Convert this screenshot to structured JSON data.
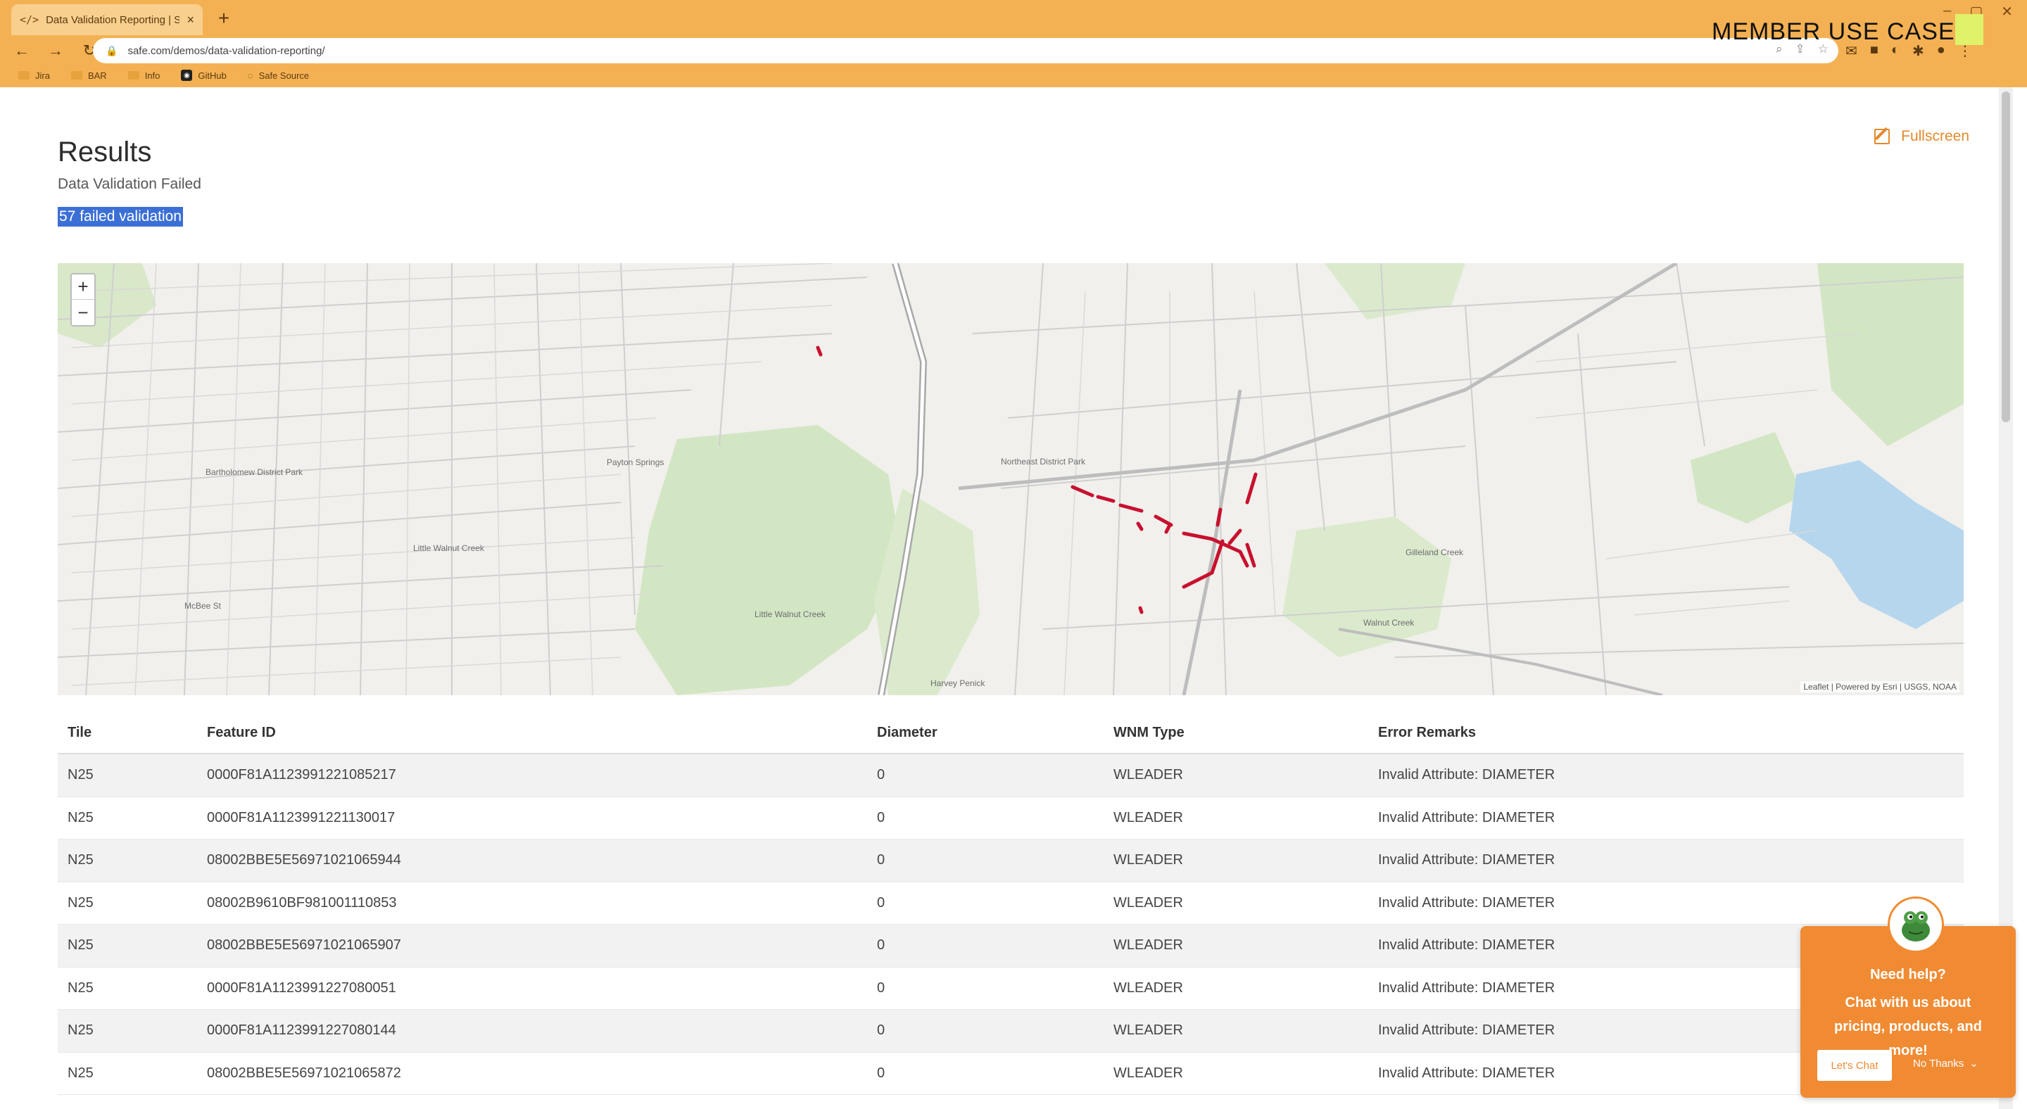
{
  "browser": {
    "tab_title": "Data Validation Reporting | Safe",
    "tab_icon": "</>",
    "new_tab": "+",
    "url": "safe.com/demos/data-validation-reporting/",
    "bookmarks": [
      "Jira",
      "BAR",
      "Info",
      "GitHub",
      "Safe Source"
    ]
  },
  "overlay": {
    "member_label": "MEMBER USE CASE"
  },
  "page": {
    "title": "Results",
    "subtitle": "Data Validation Failed",
    "failed_count": "57 failed validation",
    "fullscreen_label": "Fullscreen"
  },
  "map": {
    "zoom_in": "+",
    "zoom_out": "−",
    "attribution": "Leaflet | Powered by Esri | USGS, NOAA",
    "labels": [
      "Little Walnut Creek",
      "Little Walnut Creek",
      "Northeast District Park",
      "Gilleland Creek",
      "Walnut Creek",
      "Harvey Penick",
      "Payton Springs",
      "Bartholomew District Park",
      "McBee St"
    ]
  },
  "table": {
    "headers": [
      "Tile",
      "Feature ID",
      "Diameter",
      "WNM Type",
      "Error Remarks"
    ],
    "rows": [
      [
        "N25",
        "0000F81A1123991221085217",
        "0",
        "WLEADER",
        "Invalid Attribute: DIAMETER"
      ],
      [
        "N25",
        "0000F81A1123991221130017",
        "0",
        "WLEADER",
        "Invalid Attribute: DIAMETER"
      ],
      [
        "N25",
        "08002BBE5E56971021065944",
        "0",
        "WLEADER",
        "Invalid Attribute: DIAMETER"
      ],
      [
        "N25",
        "08002B9610BF981001110853",
        "0",
        "WLEADER",
        "Invalid Attribute: DIAMETER"
      ],
      [
        "N25",
        "08002BBE5E56971021065907",
        "0",
        "WLEADER",
        "Invalid Attribute: DIAMETER"
      ],
      [
        "N25",
        "0000F81A1123991227080051",
        "0",
        "WLEADER",
        "Invalid Attribute: DIAMETER"
      ],
      [
        "N25",
        "0000F81A1123991227080144",
        "0",
        "WLEADER",
        "Invalid Attribute: DIAMETER"
      ],
      [
        "N25",
        "08002BBE5E56971021065872",
        "0",
        "WLEADER",
        "Invalid Attribute: DIAMETER"
      ]
    ]
  },
  "chat": {
    "title": "Need help?",
    "body": "Chat with us about pricing, products, and more!",
    "primary_button": "Let's Chat",
    "dismiss": "No Thanks",
    "dismiss_icon": "chevron-down-icon"
  },
  "colors": {
    "chrome": "#f4b153",
    "accent": "#e28a2e",
    "chat": "#f08b33",
    "error_marks": "#c8102e",
    "selection": "#3b6fd6"
  }
}
